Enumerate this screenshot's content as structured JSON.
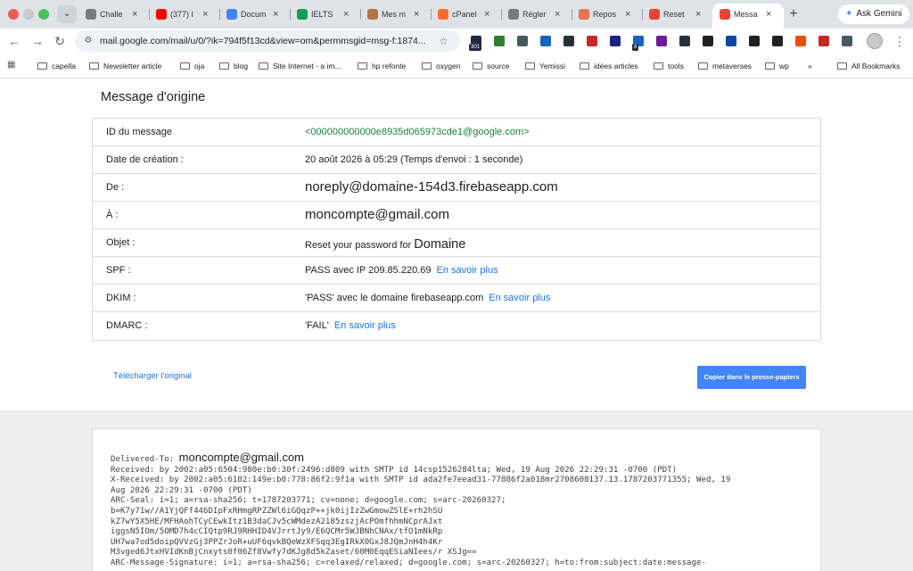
{
  "browser": {
    "tabs": [
      {
        "title": "Challe",
        "color": "#7a7a7a",
        "active": false
      },
      {
        "title": "(377) I",
        "color": "#ff0000",
        "active": false
      },
      {
        "title": "Docum",
        "color": "#4285f4",
        "active": false
      },
      {
        "title": "IELTS",
        "color": "#0f9d58",
        "active": false
      },
      {
        "title": "Mes m",
        "color": "#b0744a",
        "active": false
      },
      {
        "title": "cPanel",
        "color": "#ff6c2c",
        "active": false
      },
      {
        "title": "Régler",
        "color": "#7a7a7a",
        "active": false
      },
      {
        "title": "Repos",
        "color": "#e8744f",
        "active": false
      },
      {
        "title": "Reset",
        "color": "#ea4335",
        "active": false
      },
      {
        "title": "Messa",
        "color": "#ea4335",
        "active": true
      }
    ],
    "gemini_label": "Ask Gemini",
    "url": "mail.google.com/mail/u/0/?ik=794f5f13cd&view=om&permmsgid=msg-f:1874...",
    "extension_badges": [
      "301",
      "8"
    ],
    "bookmarks": [
      {
        "label": "capella"
      },
      {
        "label": "Newsletter article"
      },
      {
        "label": "oja"
      },
      {
        "label": "blog"
      },
      {
        "label": "Site Internet - a im..."
      },
      {
        "label": "hp refonte"
      },
      {
        "label": "oxygen"
      },
      {
        "label": "source"
      },
      {
        "label": "Yemissi"
      },
      {
        "label": "idées articles"
      },
      {
        "label": "tools"
      },
      {
        "label": "metaverses"
      },
      {
        "label": "wp"
      }
    ],
    "more_bookmarks": "»",
    "all_bookmarks": "All Bookmarks"
  },
  "message": {
    "title": "Message d'origine",
    "rows": [
      {
        "label": "ID du message",
        "value": "<000000000000e8935d065973cde1@google.com>"
      },
      {
        "label": "Date de création :",
        "value": "20 août 2026 à 05:29 (Temps d'envoi : 1 seconde)"
      },
      {
        "label": "De :",
        "value": "noreply@domaine-154d3.firebaseapp.com"
      },
      {
        "label": "À :",
        "value": "moncompte@gmail.com"
      },
      {
        "label": "Objet :",
        "value": "Reset your password for",
        "value_big": "Domaine"
      },
      {
        "label": "SPF :",
        "value": "PASS avec IP 209.85.220.69",
        "link": "En savoir plus"
      },
      {
        "label": "DKIM :",
        "value": "'PASS' avec le domaine firebaseapp.com",
        "link": "En savoir plus"
      },
      {
        "label": "DMARC :",
        "value": "'FAIL'",
        "link": "En savoir plus"
      }
    ],
    "download_label": "Télécharger l'original",
    "copy_label": "Copier dans le presse-papiers"
  },
  "raw": {
    "delivered_to_label": "Delivered-To: ",
    "delivered_to": "moncompte@gmail.com",
    "lines": [
      "Received: by 2002:a05:6504:980e:b0:30f:2496:d809 with SMTP id 14csp1526284lta; Wed, 19 Aug 2026 22:29:31 -0700 (PDT)",
      "X-Received: by 2002:a05:6102:149e:b0:778:86f2:9f1a with SMTP id ada2fe7eead31-77886f2a018mr2708608137.13.1787203771355; Wed, 19",
      "Aug 2026 22:29:31 -0700 (PDT)",
      "ARC-Seal: i=1; a=rsa-sha256; t=1787203771; cv=none; d=google.com; s=arc-20260327;",
      "b=K7y71w//A1YjQFf446DIpFxRHmgRPZZWl6iGQqzP++jk0ijIzZwGmowZSlE+rh2hSU",
      "kZ7wY5X5HE/MFHAohTCyCEwkItz1B3daCJv5cWMdezA2185zszjAcPOmfhhmNCprAJxt",
      "iggsN5IOm/5OMD7h4cCIQtp9RJ9RHHID4VJrrtJy9/E6QCMr5WJBNhCNAx/tfO1mNkRp",
      "UH7wa7od5doipQVVzGj3PPZrJoR+uUF6qvkBQeWzXFSqq3EgIRkX0GxJ8JQmJnH4h4Kr",
      "M3vged6JtxHVIdKnBjCnxyts0f06Zf8Vwfy7dKJg8d5kZaset/60M0EqqESiaNIees/r XSJg==",
      "ARC-Message-Signature: i=1; a=rsa-sha256; c=relaxed/relaxed; d=google.com; s=arc-20260327; h=to:from:subject:date:message-"
    ]
  }
}
